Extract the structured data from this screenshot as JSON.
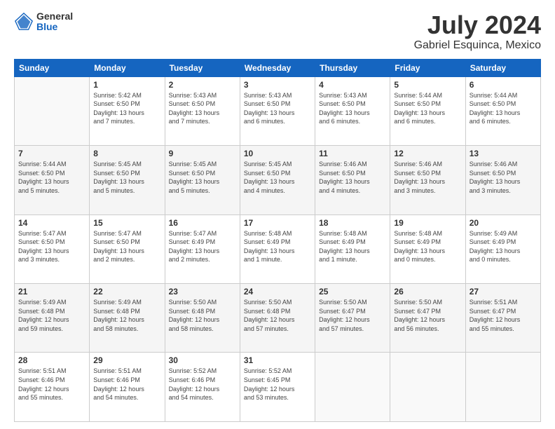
{
  "logo": {
    "general": "General",
    "blue": "Blue"
  },
  "title": "July 2024",
  "subtitle": "Gabriel Esquinca, Mexico",
  "days_of_week": [
    "Sunday",
    "Monday",
    "Tuesday",
    "Wednesday",
    "Thursday",
    "Friday",
    "Saturday"
  ],
  "weeks": [
    [
      {
        "day": "",
        "info": ""
      },
      {
        "day": "1",
        "info": "Sunrise: 5:42 AM\nSunset: 6:50 PM\nDaylight: 13 hours\nand 7 minutes."
      },
      {
        "day": "2",
        "info": "Sunrise: 5:43 AM\nSunset: 6:50 PM\nDaylight: 13 hours\nand 7 minutes."
      },
      {
        "day": "3",
        "info": "Sunrise: 5:43 AM\nSunset: 6:50 PM\nDaylight: 13 hours\nand 6 minutes."
      },
      {
        "day": "4",
        "info": "Sunrise: 5:43 AM\nSunset: 6:50 PM\nDaylight: 13 hours\nand 6 minutes."
      },
      {
        "day": "5",
        "info": "Sunrise: 5:44 AM\nSunset: 6:50 PM\nDaylight: 13 hours\nand 6 minutes."
      },
      {
        "day": "6",
        "info": "Sunrise: 5:44 AM\nSunset: 6:50 PM\nDaylight: 13 hours\nand 6 minutes."
      }
    ],
    [
      {
        "day": "7",
        "info": "Sunrise: 5:44 AM\nSunset: 6:50 PM\nDaylight: 13 hours\nand 5 minutes."
      },
      {
        "day": "8",
        "info": "Sunrise: 5:45 AM\nSunset: 6:50 PM\nDaylight: 13 hours\nand 5 minutes."
      },
      {
        "day": "9",
        "info": "Sunrise: 5:45 AM\nSunset: 6:50 PM\nDaylight: 13 hours\nand 5 minutes."
      },
      {
        "day": "10",
        "info": "Sunrise: 5:45 AM\nSunset: 6:50 PM\nDaylight: 13 hours\nand 4 minutes."
      },
      {
        "day": "11",
        "info": "Sunrise: 5:46 AM\nSunset: 6:50 PM\nDaylight: 13 hours\nand 4 minutes."
      },
      {
        "day": "12",
        "info": "Sunrise: 5:46 AM\nSunset: 6:50 PM\nDaylight: 13 hours\nand 3 minutes."
      },
      {
        "day": "13",
        "info": "Sunrise: 5:46 AM\nSunset: 6:50 PM\nDaylight: 13 hours\nand 3 minutes."
      }
    ],
    [
      {
        "day": "14",
        "info": "Sunrise: 5:47 AM\nSunset: 6:50 PM\nDaylight: 13 hours\nand 3 minutes."
      },
      {
        "day": "15",
        "info": "Sunrise: 5:47 AM\nSunset: 6:50 PM\nDaylight: 13 hours\nand 2 minutes."
      },
      {
        "day": "16",
        "info": "Sunrise: 5:47 AM\nSunset: 6:49 PM\nDaylight: 13 hours\nand 2 minutes."
      },
      {
        "day": "17",
        "info": "Sunrise: 5:48 AM\nSunset: 6:49 PM\nDaylight: 13 hours\nand 1 minute."
      },
      {
        "day": "18",
        "info": "Sunrise: 5:48 AM\nSunset: 6:49 PM\nDaylight: 13 hours\nand 1 minute."
      },
      {
        "day": "19",
        "info": "Sunrise: 5:48 AM\nSunset: 6:49 PM\nDaylight: 13 hours\nand 0 minutes."
      },
      {
        "day": "20",
        "info": "Sunrise: 5:49 AM\nSunset: 6:49 PM\nDaylight: 13 hours\nand 0 minutes."
      }
    ],
    [
      {
        "day": "21",
        "info": "Sunrise: 5:49 AM\nSunset: 6:48 PM\nDaylight: 12 hours\nand 59 minutes."
      },
      {
        "day": "22",
        "info": "Sunrise: 5:49 AM\nSunset: 6:48 PM\nDaylight: 12 hours\nand 58 minutes."
      },
      {
        "day": "23",
        "info": "Sunrise: 5:50 AM\nSunset: 6:48 PM\nDaylight: 12 hours\nand 58 minutes."
      },
      {
        "day": "24",
        "info": "Sunrise: 5:50 AM\nSunset: 6:48 PM\nDaylight: 12 hours\nand 57 minutes."
      },
      {
        "day": "25",
        "info": "Sunrise: 5:50 AM\nSunset: 6:47 PM\nDaylight: 12 hours\nand 57 minutes."
      },
      {
        "day": "26",
        "info": "Sunrise: 5:50 AM\nSunset: 6:47 PM\nDaylight: 12 hours\nand 56 minutes."
      },
      {
        "day": "27",
        "info": "Sunrise: 5:51 AM\nSunset: 6:47 PM\nDaylight: 12 hours\nand 55 minutes."
      }
    ],
    [
      {
        "day": "28",
        "info": "Sunrise: 5:51 AM\nSunset: 6:46 PM\nDaylight: 12 hours\nand 55 minutes."
      },
      {
        "day": "29",
        "info": "Sunrise: 5:51 AM\nSunset: 6:46 PM\nDaylight: 12 hours\nand 54 minutes."
      },
      {
        "day": "30",
        "info": "Sunrise: 5:52 AM\nSunset: 6:46 PM\nDaylight: 12 hours\nand 54 minutes."
      },
      {
        "day": "31",
        "info": "Sunrise: 5:52 AM\nSunset: 6:45 PM\nDaylight: 12 hours\nand 53 minutes."
      },
      {
        "day": "",
        "info": ""
      },
      {
        "day": "",
        "info": ""
      },
      {
        "day": "",
        "info": ""
      }
    ]
  ]
}
